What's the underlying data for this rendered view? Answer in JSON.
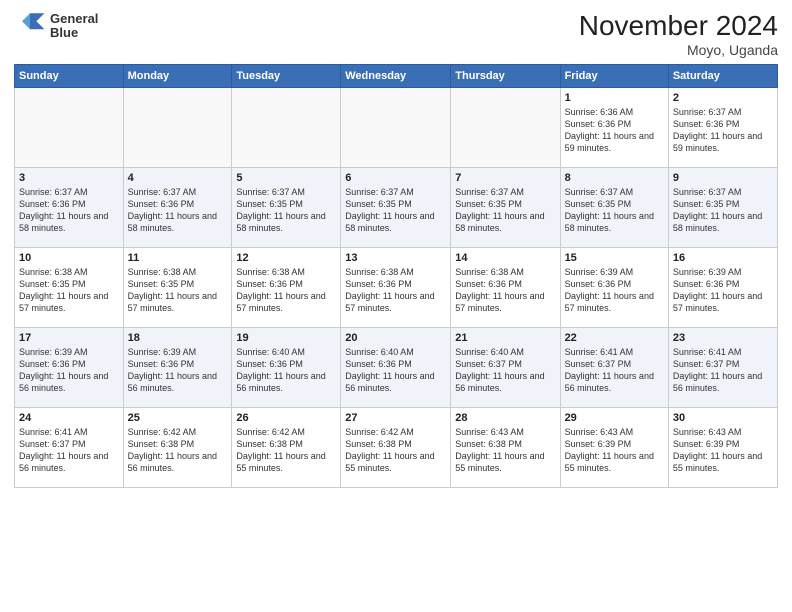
{
  "header": {
    "logo_line1": "General",
    "logo_line2": "Blue",
    "title": "November 2024",
    "subtitle": "Moyo, Uganda"
  },
  "weekdays": [
    "Sunday",
    "Monday",
    "Tuesday",
    "Wednesday",
    "Thursday",
    "Friday",
    "Saturday"
  ],
  "weeks": [
    [
      {
        "day": "",
        "info": ""
      },
      {
        "day": "",
        "info": ""
      },
      {
        "day": "",
        "info": ""
      },
      {
        "day": "",
        "info": ""
      },
      {
        "day": "",
        "info": ""
      },
      {
        "day": "1",
        "info": "Sunrise: 6:36 AM\nSunset: 6:36 PM\nDaylight: 11 hours and 59 minutes."
      },
      {
        "day": "2",
        "info": "Sunrise: 6:37 AM\nSunset: 6:36 PM\nDaylight: 11 hours and 59 minutes."
      }
    ],
    [
      {
        "day": "3",
        "info": "Sunrise: 6:37 AM\nSunset: 6:36 PM\nDaylight: 11 hours and 58 minutes."
      },
      {
        "day": "4",
        "info": "Sunrise: 6:37 AM\nSunset: 6:36 PM\nDaylight: 11 hours and 58 minutes."
      },
      {
        "day": "5",
        "info": "Sunrise: 6:37 AM\nSunset: 6:35 PM\nDaylight: 11 hours and 58 minutes."
      },
      {
        "day": "6",
        "info": "Sunrise: 6:37 AM\nSunset: 6:35 PM\nDaylight: 11 hours and 58 minutes."
      },
      {
        "day": "7",
        "info": "Sunrise: 6:37 AM\nSunset: 6:35 PM\nDaylight: 11 hours and 58 minutes."
      },
      {
        "day": "8",
        "info": "Sunrise: 6:37 AM\nSunset: 6:35 PM\nDaylight: 11 hours and 58 minutes."
      },
      {
        "day": "9",
        "info": "Sunrise: 6:37 AM\nSunset: 6:35 PM\nDaylight: 11 hours and 58 minutes."
      }
    ],
    [
      {
        "day": "10",
        "info": "Sunrise: 6:38 AM\nSunset: 6:35 PM\nDaylight: 11 hours and 57 minutes."
      },
      {
        "day": "11",
        "info": "Sunrise: 6:38 AM\nSunset: 6:35 PM\nDaylight: 11 hours and 57 minutes."
      },
      {
        "day": "12",
        "info": "Sunrise: 6:38 AM\nSunset: 6:36 PM\nDaylight: 11 hours and 57 minutes."
      },
      {
        "day": "13",
        "info": "Sunrise: 6:38 AM\nSunset: 6:36 PM\nDaylight: 11 hours and 57 minutes."
      },
      {
        "day": "14",
        "info": "Sunrise: 6:38 AM\nSunset: 6:36 PM\nDaylight: 11 hours and 57 minutes."
      },
      {
        "day": "15",
        "info": "Sunrise: 6:39 AM\nSunset: 6:36 PM\nDaylight: 11 hours and 57 minutes."
      },
      {
        "day": "16",
        "info": "Sunrise: 6:39 AM\nSunset: 6:36 PM\nDaylight: 11 hours and 57 minutes."
      }
    ],
    [
      {
        "day": "17",
        "info": "Sunrise: 6:39 AM\nSunset: 6:36 PM\nDaylight: 11 hours and 56 minutes."
      },
      {
        "day": "18",
        "info": "Sunrise: 6:39 AM\nSunset: 6:36 PM\nDaylight: 11 hours and 56 minutes."
      },
      {
        "day": "19",
        "info": "Sunrise: 6:40 AM\nSunset: 6:36 PM\nDaylight: 11 hours and 56 minutes."
      },
      {
        "day": "20",
        "info": "Sunrise: 6:40 AM\nSunset: 6:36 PM\nDaylight: 11 hours and 56 minutes."
      },
      {
        "day": "21",
        "info": "Sunrise: 6:40 AM\nSunset: 6:37 PM\nDaylight: 11 hours and 56 minutes."
      },
      {
        "day": "22",
        "info": "Sunrise: 6:41 AM\nSunset: 6:37 PM\nDaylight: 11 hours and 56 minutes."
      },
      {
        "day": "23",
        "info": "Sunrise: 6:41 AM\nSunset: 6:37 PM\nDaylight: 11 hours and 56 minutes."
      }
    ],
    [
      {
        "day": "24",
        "info": "Sunrise: 6:41 AM\nSunset: 6:37 PM\nDaylight: 11 hours and 56 minutes."
      },
      {
        "day": "25",
        "info": "Sunrise: 6:42 AM\nSunset: 6:38 PM\nDaylight: 11 hours and 56 minutes."
      },
      {
        "day": "26",
        "info": "Sunrise: 6:42 AM\nSunset: 6:38 PM\nDaylight: 11 hours and 55 minutes."
      },
      {
        "day": "27",
        "info": "Sunrise: 6:42 AM\nSunset: 6:38 PM\nDaylight: 11 hours and 55 minutes."
      },
      {
        "day": "28",
        "info": "Sunrise: 6:43 AM\nSunset: 6:38 PM\nDaylight: 11 hours and 55 minutes."
      },
      {
        "day": "29",
        "info": "Sunrise: 6:43 AM\nSunset: 6:39 PM\nDaylight: 11 hours and 55 minutes."
      },
      {
        "day": "30",
        "info": "Sunrise: 6:43 AM\nSunset: 6:39 PM\nDaylight: 11 hours and 55 minutes."
      }
    ]
  ]
}
